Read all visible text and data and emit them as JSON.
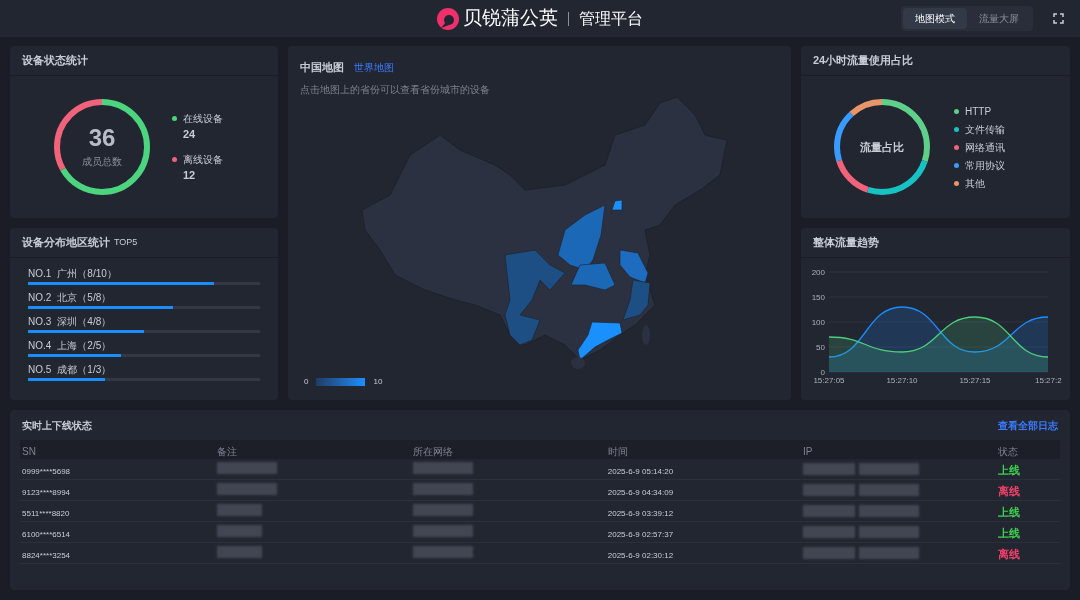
{
  "header": {
    "brand": "贝锐蒲公英",
    "subtitle": "管理平台",
    "modes": [
      {
        "label": "地图模式",
        "selected": true
      },
      {
        "label": "流量大屏",
        "selected": false
      }
    ]
  },
  "device_status": {
    "title": "设备状态统计",
    "total": "36",
    "total_label": "成员总数",
    "legend": [
      {
        "label": "在线设备",
        "value": "24",
        "color": "#4cd47f"
      },
      {
        "label": "离线设备",
        "value": "12",
        "color": "#f0637a"
      }
    ]
  },
  "top5": {
    "title": "设备分布地区统计",
    "title_suffix": "TOP5",
    "items": [
      {
        "rank": "NO.1",
        "label": "广州（8/10）",
        "level": 0.8
      },
      {
        "rank": "NO.2",
        "label": "北京（5/8）",
        "level": 0.625
      },
      {
        "rank": "NO.3",
        "label": "深圳（4/8）",
        "level": 0.5
      },
      {
        "rank": "NO.4",
        "label": "上海（2/5）",
        "level": 0.4
      },
      {
        "rank": "NO.5",
        "label": "成都（1/3）",
        "level": 0.333
      }
    ]
  },
  "map": {
    "tabs": [
      {
        "label": "中国地图",
        "selected": true
      },
      {
        "label": "世界地图",
        "selected": false
      }
    ],
    "hint": "点击地图上的省份可以查看省份城市的设备",
    "scale_min": "0",
    "scale_max": "10"
  },
  "traffic_share": {
    "title": "24小时流量使用占比",
    "center": "流量占比",
    "legend": [
      {
        "label": "HTTP",
        "color": "#5fd08a"
      },
      {
        "label": "文件传输",
        "color": "#16c2c2"
      },
      {
        "label": "网络通讯",
        "color": "#f0637a"
      },
      {
        "label": "常用协议",
        "color": "#3a9bff"
      },
      {
        "label": "其他",
        "color": "#e8956a"
      }
    ]
  },
  "trend": {
    "title": "整体流量趋势",
    "chart_data": {
      "type": "area",
      "grid": true,
      "categories": [
        "15:27:05",
        "15:27:10",
        "15:27:15",
        "15:27:2"
      ],
      "yticks": [
        0,
        50,
        100,
        150,
        200
      ],
      "ylim": [
        0,
        200
      ],
      "series": [
        {
          "color": "#1a8cff",
          "values": [
            30,
            130,
            40,
            110
          ]
        },
        {
          "color": "#4ccf7a",
          "values": [
            70,
            40,
            110,
            30
          ]
        }
      ]
    }
  },
  "log": {
    "title": "实时上下线状态",
    "link": "查看全部日志",
    "columns": [
      "SN",
      "备注",
      "所在网络",
      "时间",
      "IP",
      "状态"
    ],
    "rows": [
      {
        "sn": "0999****5698",
        "time": "2025-6-9 05:14:20",
        "status": "上线",
        "color": "#3fcf4f"
      },
      {
        "sn": "9123****8994",
        "time": "2025-6-9 04:34:09",
        "status": "离线",
        "color": "#f0406a"
      },
      {
        "sn": "5511****8820",
        "time": "2025-6-9 03:39:12",
        "status": "上线",
        "color": "#3fcf4f"
      },
      {
        "sn": "6100****6514",
        "time": "2025-6-9 02:57:37",
        "status": "上线",
        "color": "#3fcf4f"
      },
      {
        "sn": "8824****3254",
        "time": "2025-6-9 02:30:12",
        "status": "离线",
        "color": "#f0406a"
      }
    ]
  }
}
